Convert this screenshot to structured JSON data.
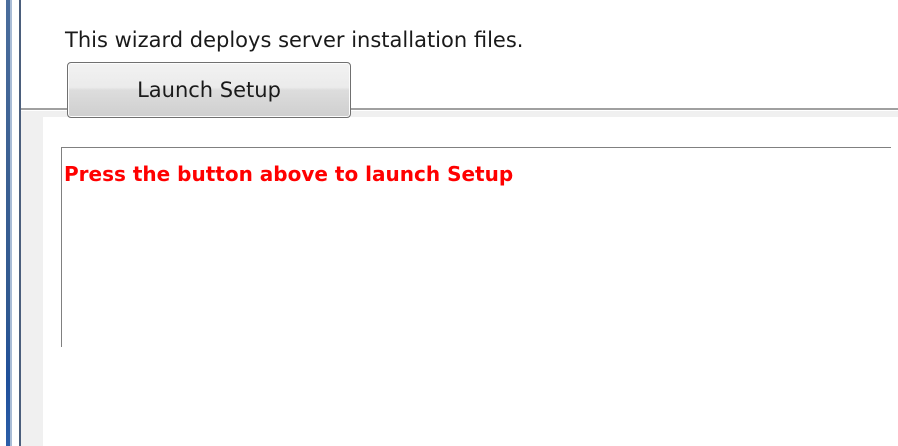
{
  "header": {
    "description": "This wizard deploys server installation files."
  },
  "actions": {
    "launch_label": "Launch Setup"
  },
  "output": {
    "status_message": "Press the button above to launch Setup",
    "status_color": "#ff0000"
  }
}
